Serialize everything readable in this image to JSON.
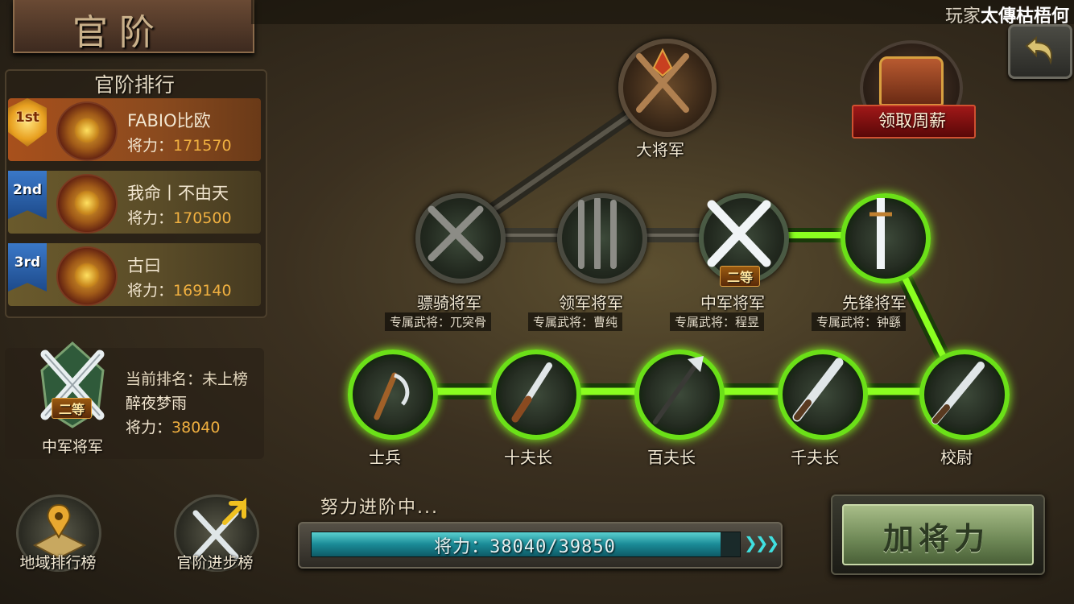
{
  "header": {
    "title": "官阶",
    "player_prefix": "玩家",
    "player_name": "太傳枯梧",
    "player_name_overflow": "何"
  },
  "ranking": {
    "title": "官阶排行",
    "power_label": "将力：",
    "entries": [
      {
        "medal": "1st",
        "name": "FABIO比欧",
        "power": "171570"
      },
      {
        "medal": "2nd",
        "name": "我命丨不由天",
        "power": "170500"
      },
      {
        "medal": "3rd",
        "name": "古曰",
        "power": "169140"
      }
    ]
  },
  "me": {
    "rank_label": "当前排名：",
    "rank_value": "未上榜",
    "name": "醉夜梦雨",
    "power_label": "将力：",
    "power": "38040",
    "grade_badge": "二等",
    "title": "中军将军"
  },
  "tree": {
    "top": {
      "label": "大将军"
    },
    "upper": [
      {
        "label": "骠骑将军",
        "hero": "专属武将：兀突骨"
      },
      {
        "label": "领军将军",
        "hero": "专属武将：曹纯"
      },
      {
        "label": "中军将军",
        "hero": "专属武将：程昱",
        "badge": "二等"
      },
      {
        "label": "先锋将军",
        "hero": "专属武将：钟繇"
      }
    ],
    "lower": [
      {
        "label": "士兵"
      },
      {
        "label": "十夫长"
      },
      {
        "label": "百夫长"
      },
      {
        "label": "千夫长"
      },
      {
        "label": "校尉"
      }
    ]
  },
  "chest": {
    "label": "领取周薪"
  },
  "bottom": {
    "region_rank_label": "地域排行榜",
    "progress_rank_label": "官阶进步榜"
  },
  "progress": {
    "caption": "努力进阶中...",
    "label": "将力：",
    "current": 38040,
    "target": 39850,
    "text": "将力：38040/39850",
    "fraction": 0.9546
  },
  "powerup": {
    "label": "加将力"
  },
  "colors": {
    "lit_path": "#6be018",
    "gold": "#f0b040",
    "progress": "#1a8a96"
  }
}
